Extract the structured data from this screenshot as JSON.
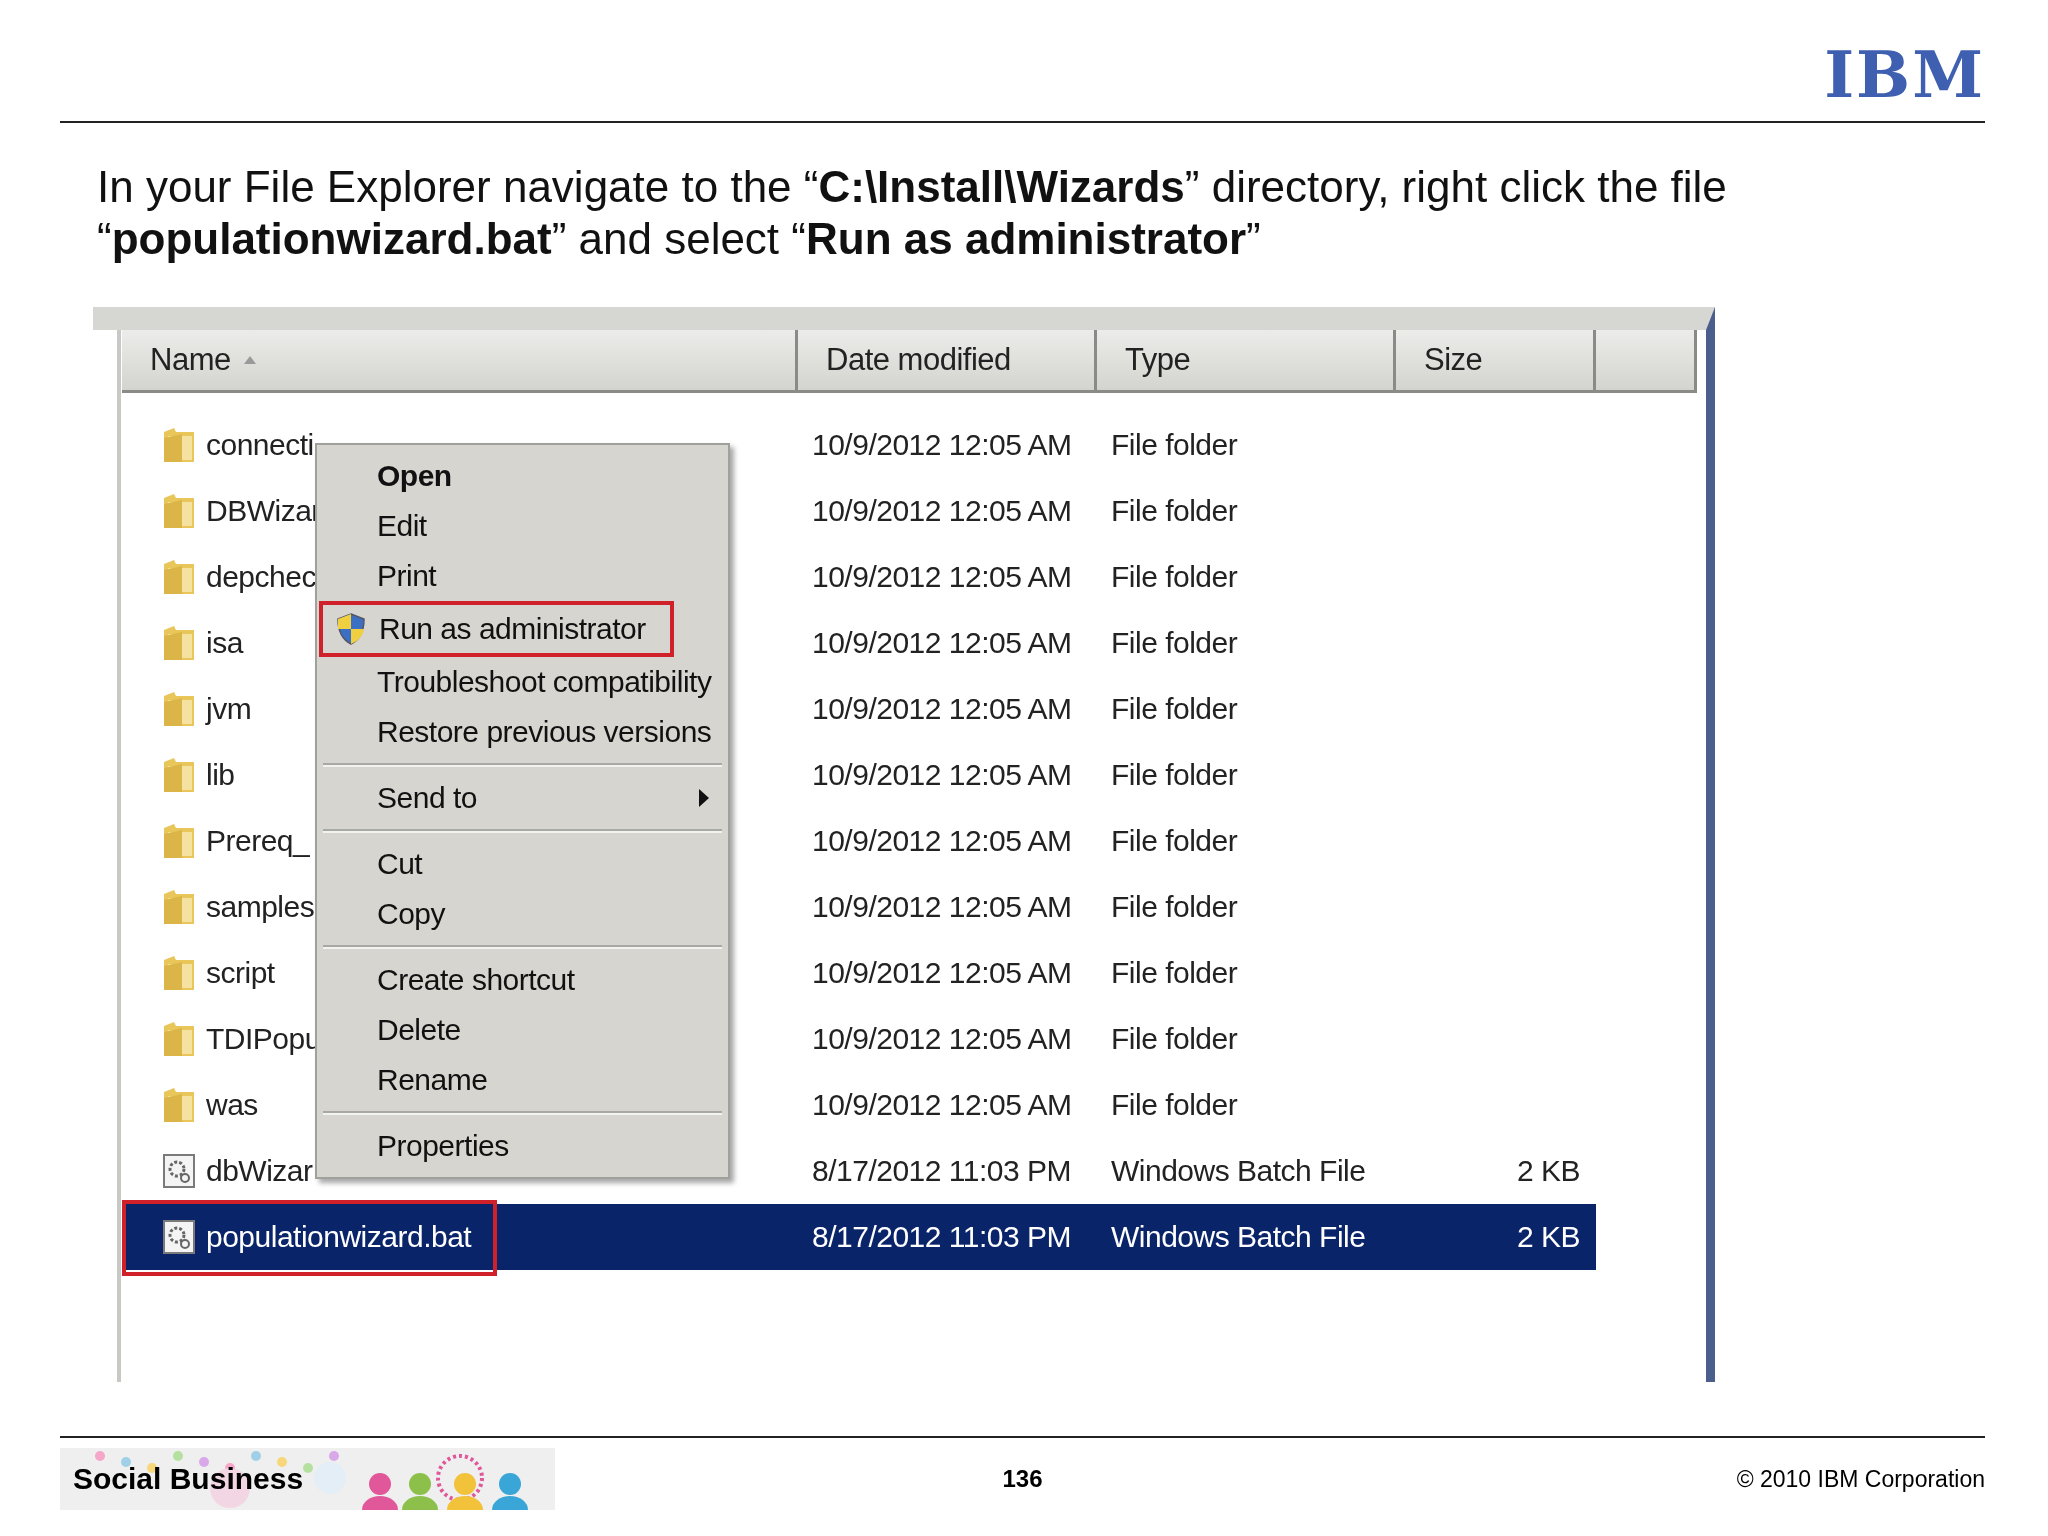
{
  "slide": {
    "logo": "IBM",
    "instruction": "In your File Explorer navigate to the “**C:\\Install\\Wizards**” directory, right click the file “**populationwizard.bat**” and select “**Run as administrator**”"
  },
  "explorer": {
    "columns": [
      {
        "label": "Name",
        "sorted": true
      },
      {
        "label": "Date modified",
        "sorted": false
      },
      {
        "label": "Type",
        "sorted": false
      },
      {
        "label": "Size",
        "sorted": false
      }
    ],
    "rows": [
      {
        "kind": "folder",
        "name": "connecti",
        "date": "10/9/2012 12:05 AM",
        "type": "File folder",
        "selected": false,
        "highlighted": false
      },
      {
        "kind": "folder",
        "name": "DBWizar",
        "date": "10/9/2012 12:05 AM",
        "type": "File folder",
        "selected": false,
        "highlighted": false
      },
      {
        "kind": "folder",
        "name": "depchec",
        "date": "10/9/2012 12:05 AM",
        "type": "File folder",
        "selected": false,
        "highlighted": false
      },
      {
        "kind": "folder",
        "name": "isa",
        "date": "10/9/2012 12:05 AM",
        "type": "File folder",
        "selected": false,
        "highlighted": false
      },
      {
        "kind": "folder",
        "name": "jvm",
        "date": "10/9/2012 12:05 AM",
        "type": "File folder",
        "selected": false,
        "highlighted": false
      },
      {
        "kind": "folder",
        "name": "lib",
        "date": "10/9/2012 12:05 AM",
        "type": "File folder",
        "selected": false,
        "highlighted": false
      },
      {
        "kind": "folder",
        "name": "Prereq_",
        "date": "10/9/2012 12:05 AM",
        "type": "File folder",
        "selected": false,
        "highlighted": false
      },
      {
        "kind": "folder",
        "name": "samples",
        "date": "10/9/2012 12:05 AM",
        "type": "File folder",
        "selected": false,
        "highlighted": false
      },
      {
        "kind": "folder",
        "name": "script",
        "date": "10/9/2012 12:05 AM",
        "type": "File folder",
        "selected": false,
        "highlighted": false
      },
      {
        "kind": "folder",
        "name": "TDIPopu",
        "date": "10/9/2012 12:05 AM",
        "type": "File folder",
        "selected": false,
        "highlighted": false
      },
      {
        "kind": "folder",
        "name": "was",
        "date": "10/9/2012 12:05 AM",
        "type": "File folder",
        "selected": false,
        "highlighted": false
      },
      {
        "kind": "batch",
        "name": "dbWizar",
        "date": "8/17/2012 11:03 PM",
        "type": "Windows Batch File",
        "size": "2 KB",
        "selected": false,
        "highlighted": false
      },
      {
        "kind": "batch",
        "name": "populationwizard.bat",
        "date": "8/17/2012 11:03 PM",
        "type": "Windows Batch File",
        "size": "2 KB",
        "selected": true,
        "highlighted": true
      }
    ],
    "context_menu": {
      "items": [
        {
          "kind": "default",
          "label": "Open",
          "highlighted": false
        },
        {
          "kind": "item",
          "label": "Edit",
          "highlighted": false
        },
        {
          "kind": "item",
          "label": "Print",
          "highlighted": false
        },
        {
          "kind": "elevated",
          "label": "Run as administrator",
          "highlighted": true
        },
        {
          "kind": "item",
          "label": "Troubleshoot compatibility",
          "highlighted": false
        },
        {
          "kind": "item",
          "label": "Restore previous versions",
          "highlighted": false
        },
        {
          "kind": "separator"
        },
        {
          "kind": "submenu",
          "label": "Send to",
          "highlighted": false
        },
        {
          "kind": "separator"
        },
        {
          "kind": "item",
          "label": "Cut",
          "highlighted": false
        },
        {
          "kind": "item",
          "label": "Copy",
          "highlighted": false
        },
        {
          "kind": "separator"
        },
        {
          "kind": "item",
          "label": "Create shortcut",
          "highlighted": false
        },
        {
          "kind": "item",
          "label": "Delete",
          "highlighted": false
        },
        {
          "kind": "item",
          "label": "Rename",
          "highlighted": false
        },
        {
          "kind": "separator"
        },
        {
          "kind": "item",
          "label": "Properties",
          "highlighted": false
        }
      ]
    }
  },
  "footer": {
    "banner": "Social Business",
    "page": "136",
    "copyright": "© 2010 IBM Corporation"
  }
}
